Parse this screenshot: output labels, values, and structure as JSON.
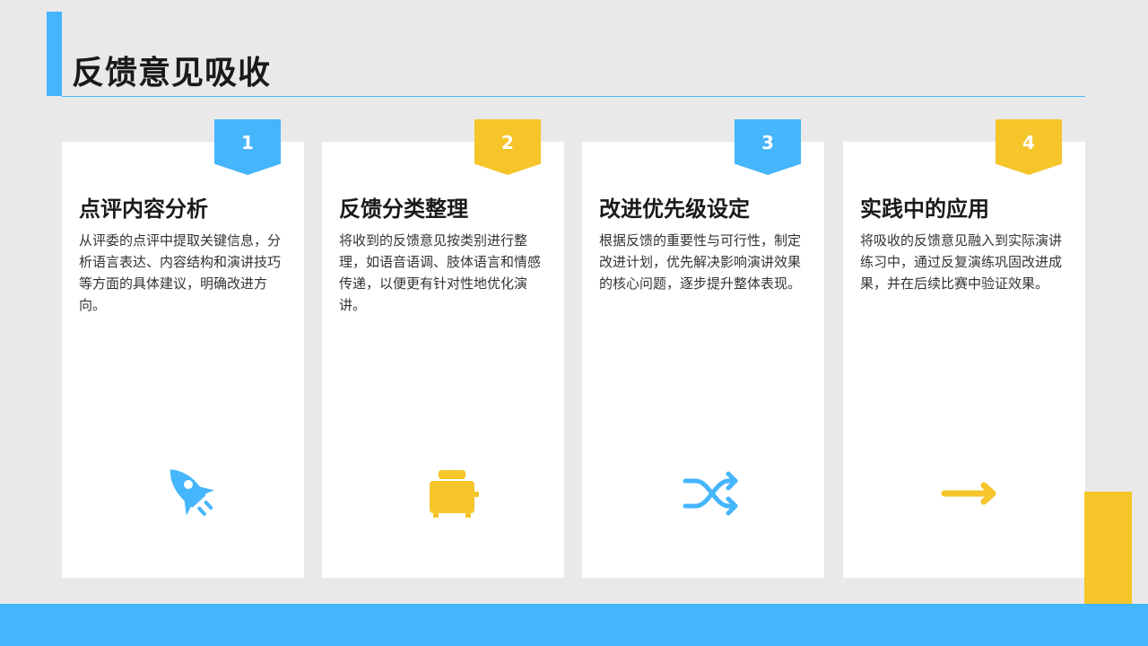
{
  "slide": {
    "title": "反馈意见吸收"
  },
  "colors": {
    "blue": "#45b5fc",
    "yellow": "#f5c52a"
  },
  "cards": [
    {
      "number": "1",
      "heading": "点评内容分析",
      "body": "从评委的点评中提取关键信息，分析语言表达、内容结构和演讲技巧等方面的具体建议，明确改进方向。",
      "icon": "rocket-icon"
    },
    {
      "number": "2",
      "heading": "反馈分类整理",
      "body": "将收到的反馈意见按类别进行整理，如语音语调、肢体语言和情感传递，以便更有针对性地优化演讲。",
      "icon": "toaster-icon"
    },
    {
      "number": "3",
      "heading": "改进优先级设定",
      "body": "根据反馈的重要性与可行性，制定改进计划，优先解决影响演讲效果的核心问题，逐步提升整体表现。",
      "icon": "shuffle-icon"
    },
    {
      "number": "4",
      "heading": "实践中的应用",
      "body": "将吸收的反馈意见融入到实际演讲练习中，通过反复演练巩固改进成果，并在后续比赛中验证效果。",
      "icon": "arrow-right-icon"
    }
  ]
}
